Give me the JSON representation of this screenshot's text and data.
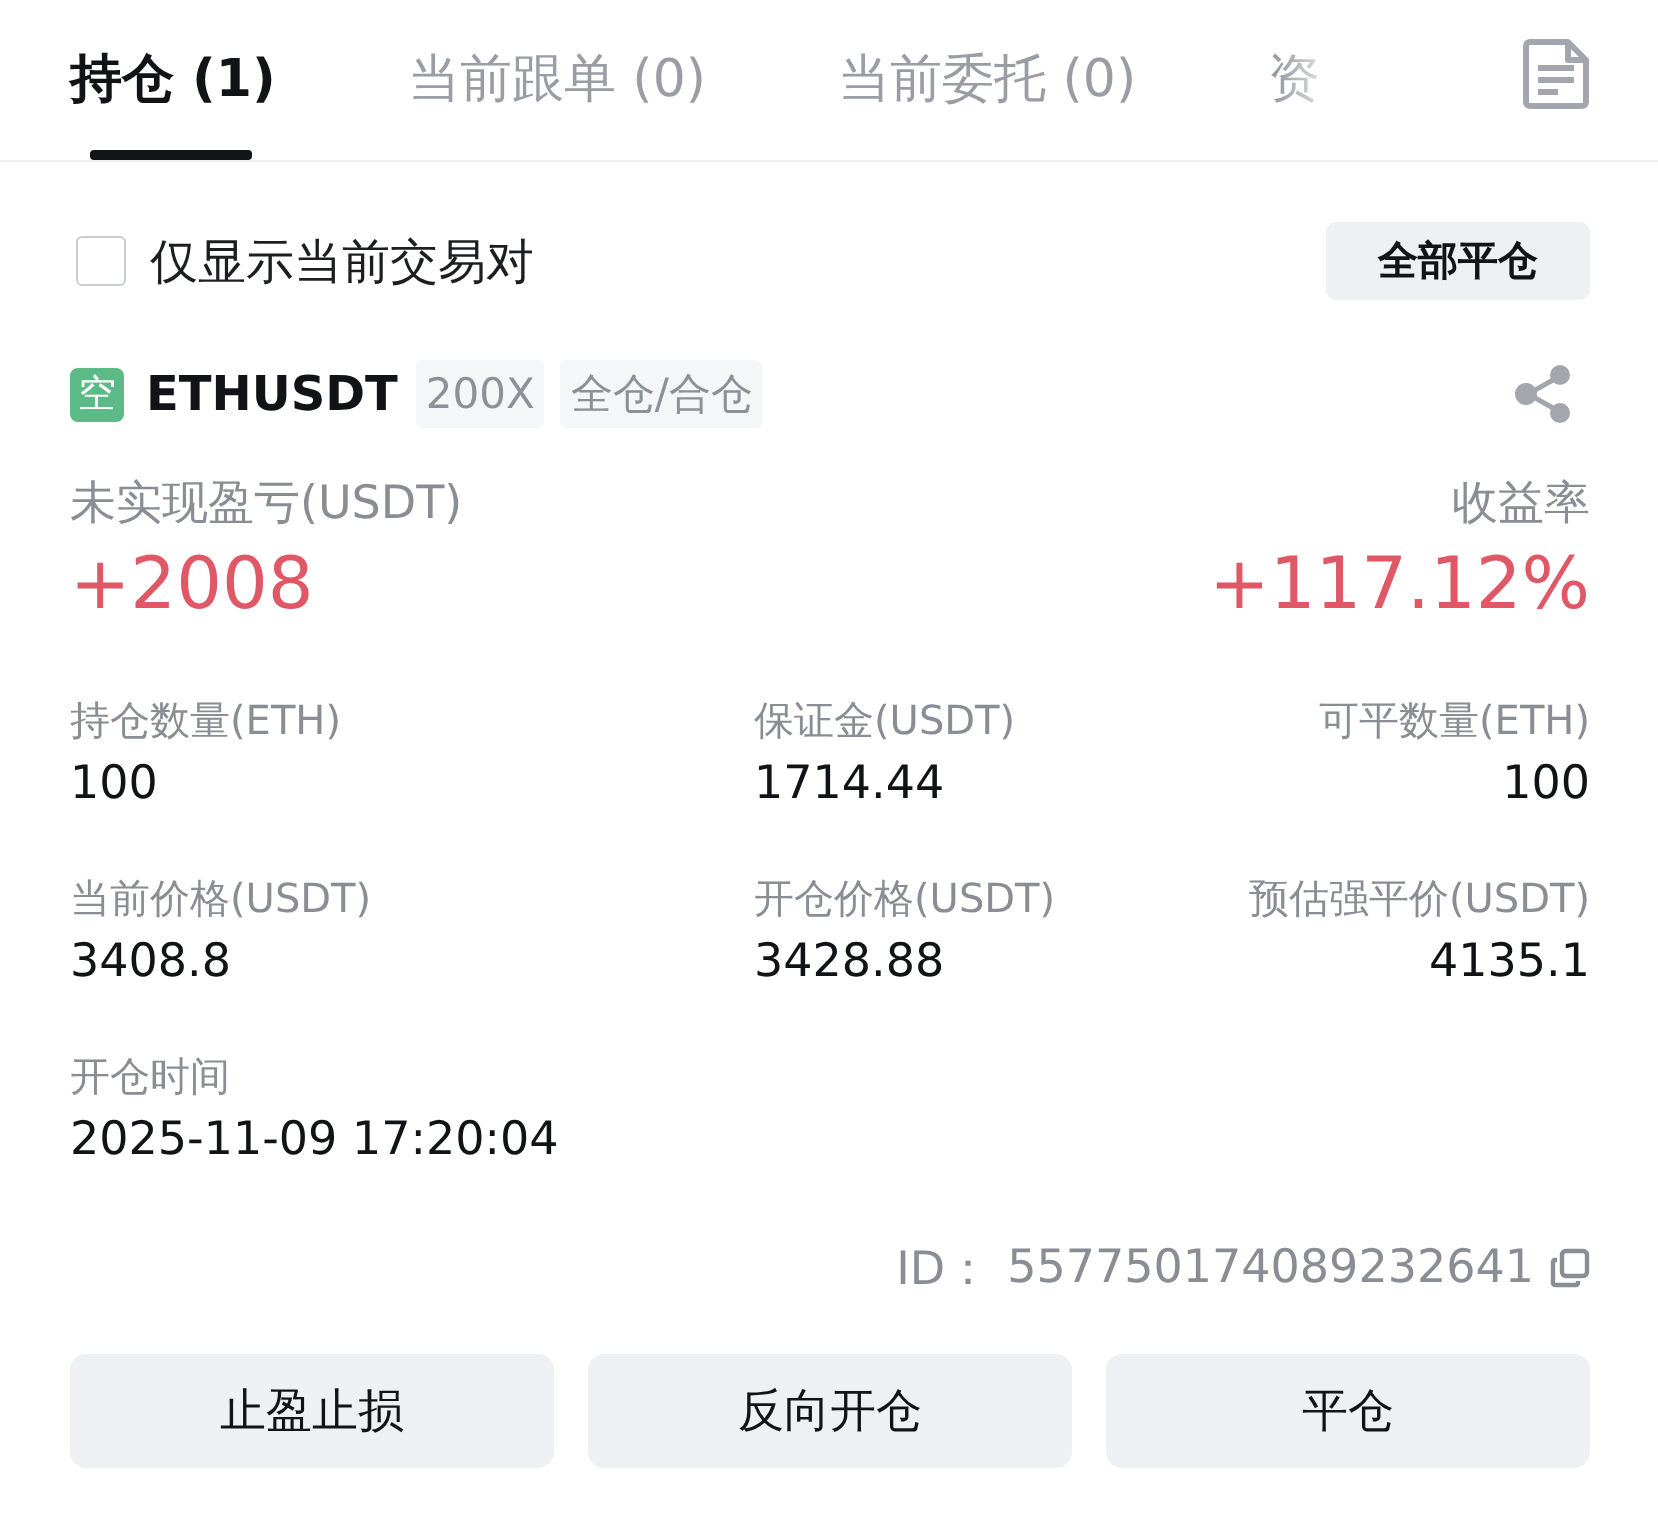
{
  "tabs": [
    {
      "label": "持仓 (1)",
      "selected": true
    },
    {
      "label": "当前跟单 (0)",
      "selected": false
    },
    {
      "label": "当前委托 (0)",
      "selected": false
    },
    {
      "label": "资",
      "selected": false
    }
  ],
  "filter": {
    "label": "仅显示当前交易对",
    "checked": false
  },
  "close_all_button": "全部平仓",
  "position": {
    "side": "空",
    "symbol": "ETHUSDT",
    "tags": [
      "200X",
      "全仓/合仓"
    ],
    "pnl_label": "未实现盈亏(USDT)",
    "pnl_value": "+2008",
    "roi_label": "收益率",
    "roi_value": "+117.12%",
    "fields": [
      {
        "label": "持仓数量(ETH)",
        "value": "100"
      },
      {
        "label": "保证金(USDT)",
        "value": "1714.44"
      },
      {
        "label": "可平数量(ETH)",
        "value": "100"
      },
      {
        "label": "当前价格(USDT)",
        "value": "3408.8"
      },
      {
        "label": "开仓价格(USDT)",
        "value": "3428.88"
      },
      {
        "label": "预估强平价(USDT)",
        "value": "4135.1"
      },
      {
        "label": "开仓时间",
        "value": "2025-11-09 17:20:04"
      }
    ],
    "id_label": "ID：",
    "id_value": "557750174089232641"
  },
  "actions": [
    "止盈止损",
    "反向开仓",
    "平仓"
  ]
}
